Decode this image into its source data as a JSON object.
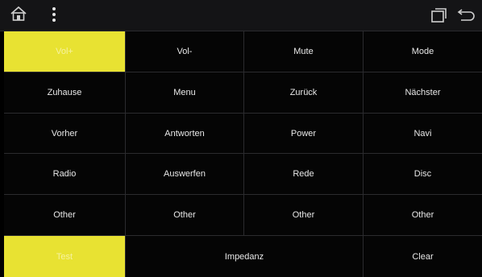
{
  "statusbar": {
    "home_icon": "home-icon",
    "menu_icon": "more-vertical-icon",
    "recents_icon": "recent-apps-icon",
    "back_icon": "back-arrow-icon"
  },
  "buttons": {
    "r1": [
      "Vol+",
      "Vol-",
      "Mute",
      "Mode"
    ],
    "r2": [
      "Zuhause",
      "Menu",
      "Zurück",
      "Nächster"
    ],
    "r3": [
      "Vorher",
      "Antworten",
      "Power",
      "Navi"
    ],
    "r4": [
      "Radio",
      "Auswerfen",
      "Rede",
      "Disc"
    ],
    "r5": [
      "Other",
      "Other",
      "Other",
      "Other"
    ],
    "r6": [
      "Test",
      "Impedanz",
      "Clear"
    ]
  },
  "colors": {
    "accent_yellow": "#e8e232",
    "background": "#000000"
  }
}
